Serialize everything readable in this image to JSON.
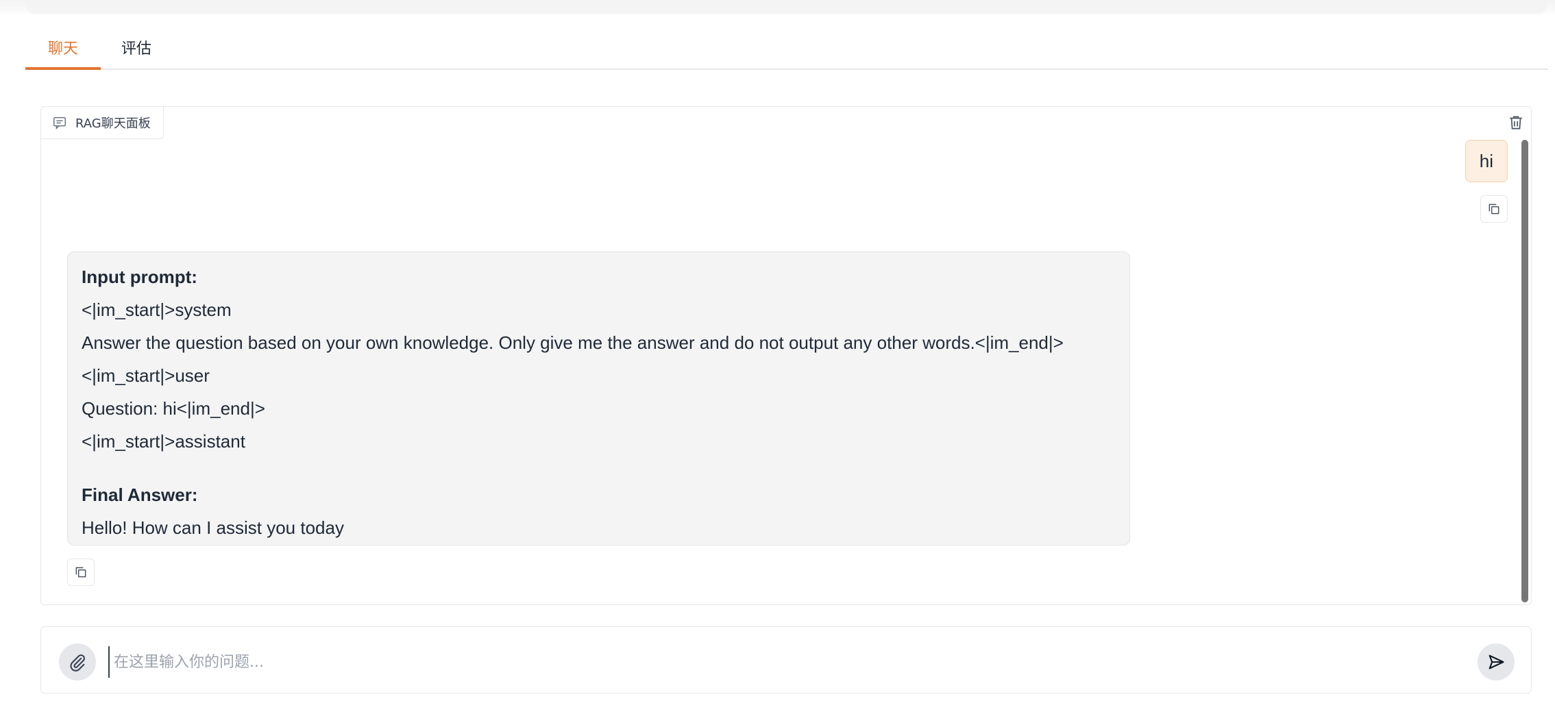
{
  "tabs": {
    "chat_label": "聊天",
    "eval_label": "评估"
  },
  "chat_panel": {
    "label": "RAG聊天面板",
    "label_icon": "chat-icon",
    "clear_icon": "trash-icon"
  },
  "messages": {
    "user": {
      "text": "hi"
    },
    "bot": {
      "input_prompt_heading": "Input prompt:",
      "lines": [
        "<|im_start|>system",
        "Answer the question based on your own knowledge. Only give me the answer and do not output any other words.<|im_end|>",
        "<|im_start|>user",
        "Question: hi<|im_end|>",
        "<|im_start|>assistant"
      ],
      "final_answer_heading": "Final Answer:",
      "final_answer": "Hello! How can I assist you today"
    }
  },
  "input": {
    "placeholder": "在这里输入你的问题...",
    "value": "",
    "attach_icon": "paperclip-icon",
    "send_icon": "send-icon"
  },
  "colors": {
    "accent": "#e2752f",
    "user_bubble_bg": "#fdf0e2",
    "bot_bubble_bg": "#f4f4f5"
  }
}
